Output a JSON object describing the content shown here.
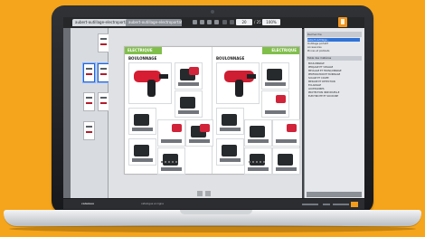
{
  "window": {
    "tabs": [
      {
        "label": "aubert-outillage-electroportatif-2023"
      },
      {
        "label": "aubert-outillage-electroportatif-2023"
      }
    ],
    "page_field": "20",
    "page_total": "/ 25",
    "zoom": "100%"
  },
  "document": {
    "left_header": "ELECTRIQUE",
    "right_header": "ELECTRIQUE",
    "left_section": "BOULONNAGE",
    "right_section": "BOULONNAGE"
  },
  "sidebar": {
    "panel_title": "Recherche",
    "items": [
      {
        "label": "aubert-outillage...",
        "selected": true
      },
      {
        "label": "Outillage portatif",
        "selected": false
      },
      {
        "label": "Accessoires",
        "selected": false
      },
      {
        "label": "Pinces et pistolets",
        "selected": false
      }
    ],
    "outline_title": "Table des matières",
    "outline": [
      "BOULONNAGE",
      "PERÇAGE ET VISSAGE",
      "MEULAGE ET TRONÇONNAGE",
      "PERFORATION ET BURINAGE",
      "SCIAGE ET COUPE",
      "MESURE ET DÉTECTION",
      "ÉCLAIRAGE",
      "ACCESSOIRES",
      "PROTECTION INDIVIDUELLE",
      "ÉLECTRICITÉ ET SOUDURE"
    ]
  },
  "status": {
    "brand": "calameo",
    "text": "catalogue en ligne",
    "accent_color": "#F39C1C"
  }
}
